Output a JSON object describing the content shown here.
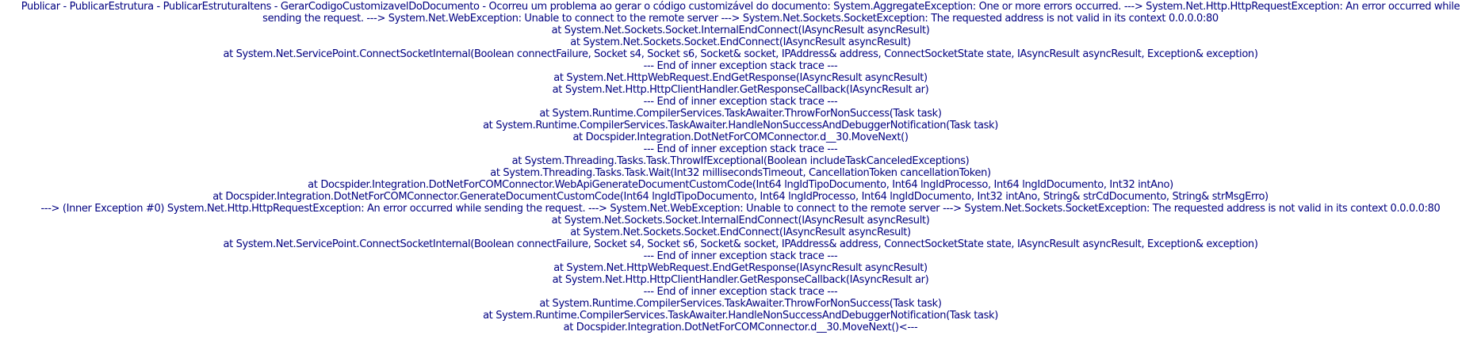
{
  "error": {
    "lines": [
      "Publicar - PublicarEstrutura - PublicarEstruturaItens - GerarCodigoCustomizavelDoDocumento - Ocorreu um problema ao gerar o código customizável do documento: System.AggregateException: One or more errors occurred. ---> System.Net.Http.HttpRequestException: An error occurred while sending the request. ---> System.Net.WebException: Unable to connect to the remote server ---> System.Net.Sockets.SocketException: The requested address is not valid in its context 0.0.0.0:80",
      "at System.Net.Sockets.Socket.InternalEndConnect(IAsyncResult asyncResult)",
      "at System.Net.Sockets.Socket.EndConnect(IAsyncResult asyncResult)",
      "at System.Net.ServicePoint.ConnectSocketInternal(Boolean connectFailure, Socket s4, Socket s6, Socket& socket, IPAddress& address, ConnectSocketState state, IAsyncResult asyncResult, Exception& exception)",
      "--- End of inner exception stack trace ---",
      "at System.Net.HttpWebRequest.EndGetResponse(IAsyncResult asyncResult)",
      "at System.Net.Http.HttpClientHandler.GetResponseCallback(IAsyncResult ar)",
      "--- End of inner exception stack trace ---",
      "at System.Runtime.CompilerServices.TaskAwaiter.ThrowForNonSuccess(Task task)",
      "at System.Runtime.CompilerServices.TaskAwaiter.HandleNonSuccessAndDebuggerNotification(Task task)",
      "at Docspider.Integration.DotNetForCOMConnector.d__30.MoveNext()",
      "--- End of inner exception stack trace ---",
      "at System.Threading.Tasks.Task.ThrowIfExceptional(Boolean includeTaskCanceledExceptions)",
      "at System.Threading.Tasks.Task.Wait(Int32 millisecondsTimeout, CancellationToken cancellationToken)",
      "at Docspider.Integration.DotNetForCOMConnector.WebApiGenerateDocumentCustomCode(Int64 lngIdTipoDocumento, Int64 lngIdProcesso, Int64 lngIdDocumento, Int32 intAno)",
      "at Docspider.Integration.DotNetForCOMConnector.GenerateDocumentCustomCode(Int64 lngIdTipoDocumento, Int64 lngIdProcesso, Int64 lngIdDocumento, Int32 intAno, String& strCdDocumento, String& strMsgErro)",
      "---> (Inner Exception #0) System.Net.Http.HttpRequestException: An error occurred while sending the request. ---> System.Net.WebException: Unable to connect to the remote server ---> System.Net.Sockets.SocketException: The requested address is not valid in its context 0.0.0.0:80",
      "at System.Net.Sockets.Socket.InternalEndConnect(IAsyncResult asyncResult)",
      "at System.Net.Sockets.Socket.EndConnect(IAsyncResult asyncResult)",
      "at System.Net.ServicePoint.ConnectSocketInternal(Boolean connectFailure, Socket s4, Socket s6, Socket& socket, IPAddress& address, ConnectSocketState state, IAsyncResult asyncResult, Exception& exception)",
      "--- End of inner exception stack trace ---",
      "at System.Net.HttpWebRequest.EndGetResponse(IAsyncResult asyncResult)",
      "at System.Net.Http.HttpClientHandler.GetResponseCallback(IAsyncResult ar)",
      "--- End of inner exception stack trace ---",
      "at System.Runtime.CompilerServices.TaskAwaiter.ThrowForNonSuccess(Task task)",
      "at System.Runtime.CompilerServices.TaskAwaiter.HandleNonSuccessAndDebuggerNotification(Task task)",
      "at Docspider.Integration.DotNetForCOMConnector.d__30.MoveNext()<---"
    ],
    "text_color": "#000080"
  }
}
